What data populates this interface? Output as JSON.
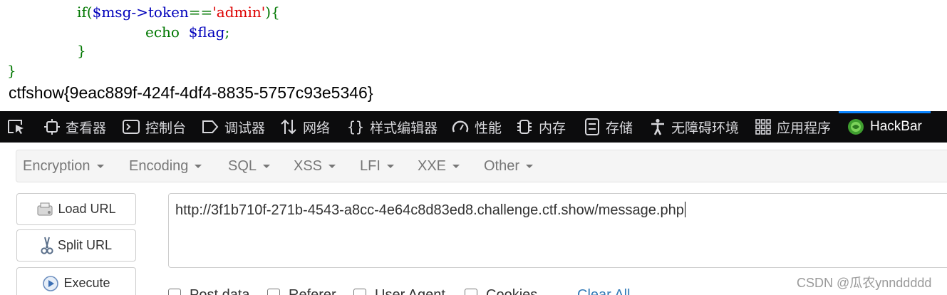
{
  "source_code": {
    "line1": {
      "kw": "if(",
      "var": "$msg->token",
      "op": "==",
      "str": "'admin'",
      "end": "){"
    },
    "line2": {
      "kw": "echo",
      "var": "$flag",
      "end": ";"
    },
    "line3": "}",
    "line4": "}",
    "output": "ctfshow{9eac889f-424f-4df4-8835-5757c93e5346}"
  },
  "devtools": {
    "tabs": [
      {
        "label": "查看器",
        "icon": "inspector-icon"
      },
      {
        "label": "控制台",
        "icon": "console-icon"
      },
      {
        "label": "调试器",
        "icon": "debugger-icon"
      },
      {
        "label": "网络",
        "icon": "network-icon"
      },
      {
        "label": "样式编辑器",
        "icon": "style-editor-icon"
      },
      {
        "label": "性能",
        "icon": "performance-icon"
      },
      {
        "label": "内存",
        "icon": "memory-icon"
      },
      {
        "label": "存储",
        "icon": "storage-icon"
      },
      {
        "label": "无障碍环境",
        "icon": "accessibility-icon"
      },
      {
        "label": "应用程序",
        "icon": "application-icon"
      },
      {
        "label": "HackBar",
        "icon": "hackbar-icon"
      }
    ],
    "active_tab": "HackBar",
    "accent": "#0a84ff"
  },
  "hackbar": {
    "menus": [
      "Encryption",
      "Encoding",
      "SQL",
      "XSS",
      "LFI",
      "XXE",
      "Other"
    ],
    "buttons": {
      "load": "Load URL",
      "split": "Split URL",
      "execute": "Execute"
    },
    "url": "http://3f1b710f-271b-4543-a8cc-4e64c8d83ed8.challenge.ctf.show/message.php",
    "options": [
      "Post data",
      "Referer",
      "User Agent",
      "Cookies"
    ],
    "clear_all": "Clear All"
  },
  "watermark": "CSDN @瓜农ynnddddd"
}
